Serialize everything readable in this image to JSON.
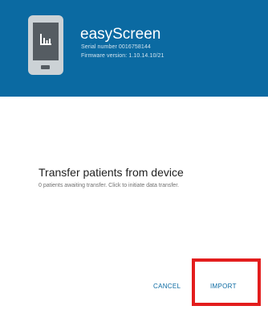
{
  "header": {
    "app_title": "easyScreen",
    "serial_text": "Serial number 0016758144",
    "firmware_text": "Firmware version: 1.10.14.10/21",
    "device_icon": "tablet-device-icon",
    "screen_icon": "bar-chart-icon",
    "background_color": "#0b6aa2"
  },
  "dialog": {
    "title": "Transfer patients from device",
    "message": "0 patients awaiting transfer. Click to initiate data transfer."
  },
  "actions": {
    "cancel_label": "CANCEL",
    "import_label": "IMPORT",
    "accent_color": "#0b6aa2"
  },
  "annotation": {
    "highlight_color": "#e31d1d"
  }
}
